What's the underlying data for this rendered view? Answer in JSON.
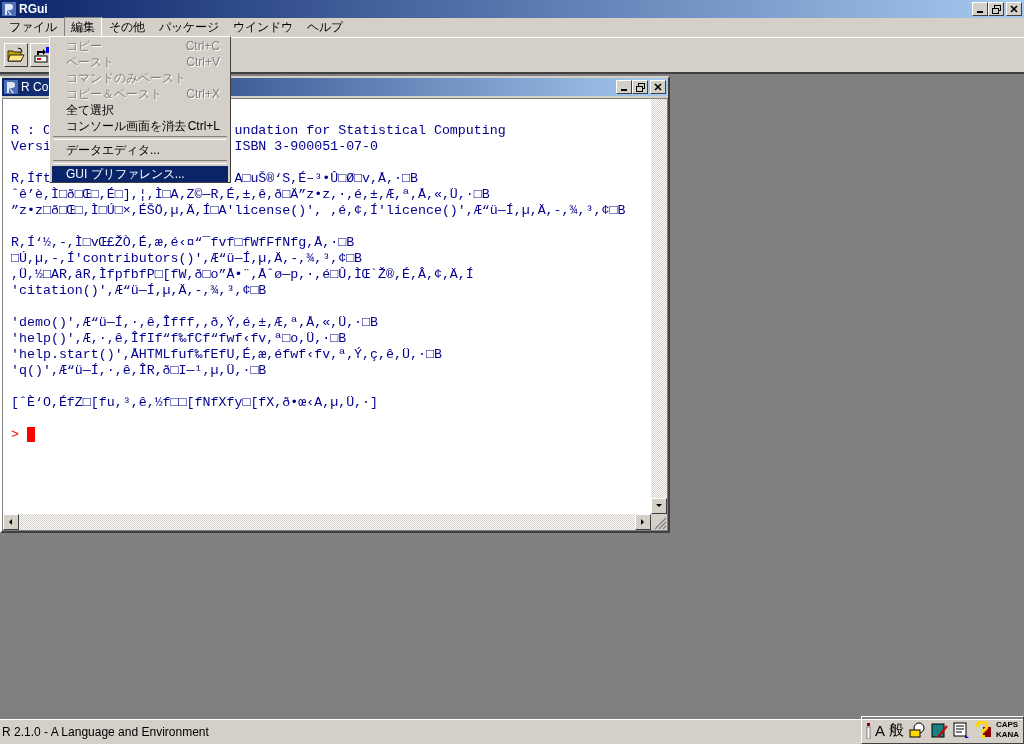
{
  "window": {
    "title": "RGui"
  },
  "menu_bar": [
    {
      "label": "ファイル",
      "selected": false
    },
    {
      "label": "編集",
      "selected": true
    },
    {
      "label": "その他",
      "selected": false
    },
    {
      "label": "パッケージ",
      "selected": false
    },
    {
      "label": "ウインドウ",
      "selected": false
    },
    {
      "label": "ヘルプ",
      "selected": false
    }
  ],
  "dropdown": [
    {
      "kind": "item",
      "label": "コピー",
      "shortcut": "Ctrl+C",
      "disabled": true,
      "selected": false
    },
    {
      "kind": "item",
      "label": "ペースト",
      "shortcut": "Ctrl+V",
      "disabled": true,
      "selected": false
    },
    {
      "kind": "item",
      "label": "コマンドのみペースト",
      "disabled": true,
      "selected": false
    },
    {
      "kind": "item",
      "label": "コピー＆ペースト",
      "shortcut": "Ctrl+X",
      "disabled": true,
      "selected": false
    },
    {
      "kind": "item",
      "label": "全て選択",
      "disabled": false,
      "selected": false
    },
    {
      "kind": "item",
      "label": "コンソール画面を消去",
      "shortcut": "Ctrl+L",
      "disabled": false,
      "selected": false
    },
    {
      "kind": "separator"
    },
    {
      "kind": "item",
      "label": "データエディタ...",
      "disabled": false,
      "selected": false
    },
    {
      "kind": "separator"
    },
    {
      "kind": "item",
      "label": "GUI プリファレンス...",
      "disabled": false,
      "selected": true
    }
  ],
  "console": {
    "title": "R Co",
    "lines": [
      {
        "kind": "blank"
      },
      {
        "kind": "split",
        "segments": [
          "R : C",
          "undation for Statistical Computing"
        ]
      },
      {
        "kind": "split",
        "segments": [
          "Versi",
          "ISBN 3-900051-07-0"
        ]
      },
      {
        "kind": "blank"
      },
      {
        "kind": "split",
        "segments": [
          "R,Íft",
          "A□uŠ®‘S,É–³•Û□Ø□v,Å,·□B"
        ]
      },
      {
        "kind": "text",
        "text": "ˆê’è,Ì□ð□Œ□,É□],¦,Ì□A‚Z©—R,É,±,ê,ð□Ä”z•z,·,é,±,Æ,ª,Å,«,Ü,·□B"
      },
      {
        "kind": "text",
        "text": "”z•z□ð□Œ□,Ì□Ú□×,ÉŠÖ,µ,Ä,Í□A'license()', ,é,¢,Í'licence()',Æ“ü—Í,µ,Ä,-,¾,³,¢□B"
      },
      {
        "kind": "blank"
      },
      {
        "kind": "text",
        "text": "R,Í‘½,-,Ì□vŒ£ŽÒ,É,æ,é‹¤“¯fvf□fWfFfNfg,Å,·□B"
      },
      {
        "kind": "text",
        "text": "□Ú,µ,-,Í'contributors()',Æ“ü—Í,µ,Ä,-,¾,³,¢□B"
      },
      {
        "kind": "text",
        "text": ",Ü,½□AR,âR,ÌfpfbfP□[fW,ð□o”Å•¨,Åˆø—p,·,é□Û,ÌŒ`Ž®,É,Â,¢,Ä,Í"
      },
      {
        "kind": "text",
        "text": "'citation()',Æ“ü—Í,µ,Ä,-,¾,³,¢□B"
      },
      {
        "kind": "blank"
      },
      {
        "kind": "text",
        "text": "'demo()',Æ“ü—Í,·,ê,Îfff,,ð,Ý,é,±,Æ,ª,Å,«,Ü,·□B"
      },
      {
        "kind": "text",
        "text": "'help()',Æ,·,ê,ÎfIf“f‰fCf“fwf‹fv,ª□o,Ü,·□B"
      },
      {
        "kind": "text",
        "text": "'help.start()',ÅHTMLfuf‰fEfU,É,æ,éfwf‹fv,ª,Ý,ç,ê,Ü,·□B"
      },
      {
        "kind": "text",
        "text": "'q()',Æ“ü—Í,·,ê,ÎR,ð□I—¹,µ,Ü,·□B"
      },
      {
        "kind": "blank"
      },
      {
        "kind": "text",
        "text": "[ˆÈ‘O,ÉfZ□[fu,³,ê,½f□□[fNfXfy□[fX,ð•œ‹A,µ,Ü,·]"
      },
      {
        "kind": "blank"
      },
      {
        "kind": "prompt",
        "text": ">"
      }
    ]
  },
  "status_bar": {
    "text": "R 2.1.0 - A Language and Environment"
  },
  "ime_bar": {
    "mode": "A",
    "dictionary": "般",
    "caps": "CAPS",
    "kana": "KANA"
  }
}
